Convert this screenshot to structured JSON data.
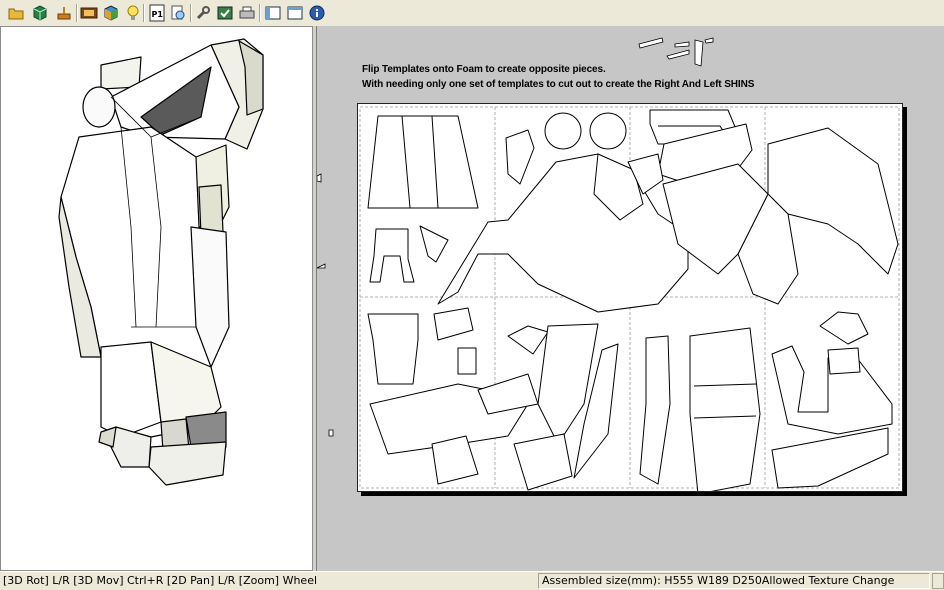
{
  "toolbar": {
    "buttons": [
      {
        "name": "open-folder-icon"
      },
      {
        "name": "3d-model-icon"
      },
      {
        "name": "brush-icon"
      },
      {
        "name": "texture-icon"
      },
      {
        "name": "colored-cube-icon"
      },
      {
        "name": "lightbulb-icon"
      },
      {
        "name": "page-icon",
        "label": "P1"
      },
      {
        "name": "print-preview-icon"
      },
      {
        "name": "wrench-icon"
      },
      {
        "name": "check-object-icon"
      },
      {
        "name": "printer-icon"
      },
      {
        "name": "layout-icon"
      },
      {
        "name": "window-icon"
      },
      {
        "name": "info-icon"
      }
    ]
  },
  "annotations": {
    "line1": "Flip Templates onto Foam to create opposite pieces.",
    "line2": "With needing only one set of templates to cut out to create the Right And Left SHINS"
  },
  "status": {
    "hint": "[3D Rot] L/R [3D Mov] Ctrl+R [2D Pan] L/R [Zoom] Wheel",
    "info": "Assembled size(mm): H555 W189 D250Allowed Texture Change"
  },
  "colors": {
    "window_bg": "#ece9d8",
    "viewport_2d_bg": "#c6c6c6",
    "sheet_bg": "#ffffff"
  }
}
